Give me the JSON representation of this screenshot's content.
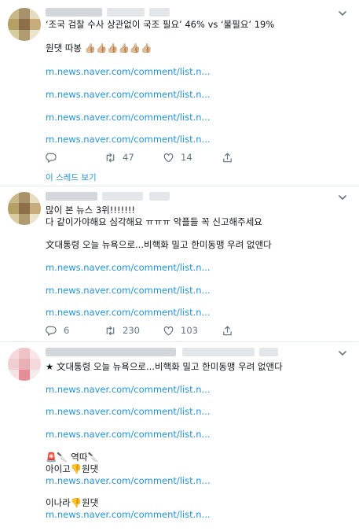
{
  "tweets": [
    {
      "lines": [
        "‘조국 검찰 수사 상관없이 국조 필요’ 46% vs ‘불필요’ 19%",
        "원댓 따봉 👍🏼👍🏼👍🏼👍🏼👍🏼👍🏼"
      ],
      "links": [
        "m.news.naver.com/comment/list.n...",
        "m.news.naver.com/comment/list.n...",
        "m.news.naver.com/comment/list.n...",
        "m.news.naver.com/comment/list.n..."
      ],
      "retweets": "47",
      "likes": "14",
      "thread_label": "이 스레드 보기"
    },
    {
      "lines": [
        "많이 본 뉴스 3위!!!!!!!",
        "다 같이가야해요 심각해요 ㅠㅠㅠ 악플들 꼭 신고해주세요",
        "文대통령 오늘 뉴욕으로...비핵화 밀고 한미동맹 우려 없앤다"
      ],
      "links": [
        "m.news.naver.com/comment/list.n...",
        "m.news.naver.com/comment/list.n...",
        "m.news.naver.com/comment/list.n..."
      ],
      "replies": "6",
      "retweets": "230",
      "likes": "103"
    },
    {
      "lines": [
        "★ 文대통령 오늘 뉴욕으로...비핵화 밀고 한미동맹 우려 없앤다",
        "🚨🔪 역따🔪",
        "아이고👎원댓",
        "이나라👎원댓"
      ],
      "links": [
        "m.news.naver.com/comment/list.n...",
        "m.news.naver.com/comment/list.n...",
        "m.news.naver.com/comment/list.n...",
        "m.news.naver.com/comment/list.n..."
      ]
    }
  ],
  "colors": {
    "link": "#1b95e0",
    "muted": "#657786",
    "divider": "#e6ecf0"
  },
  "icons": [
    "caret-down-icon",
    "reply-icon",
    "retweet-icon",
    "like-icon",
    "share-icon"
  ]
}
